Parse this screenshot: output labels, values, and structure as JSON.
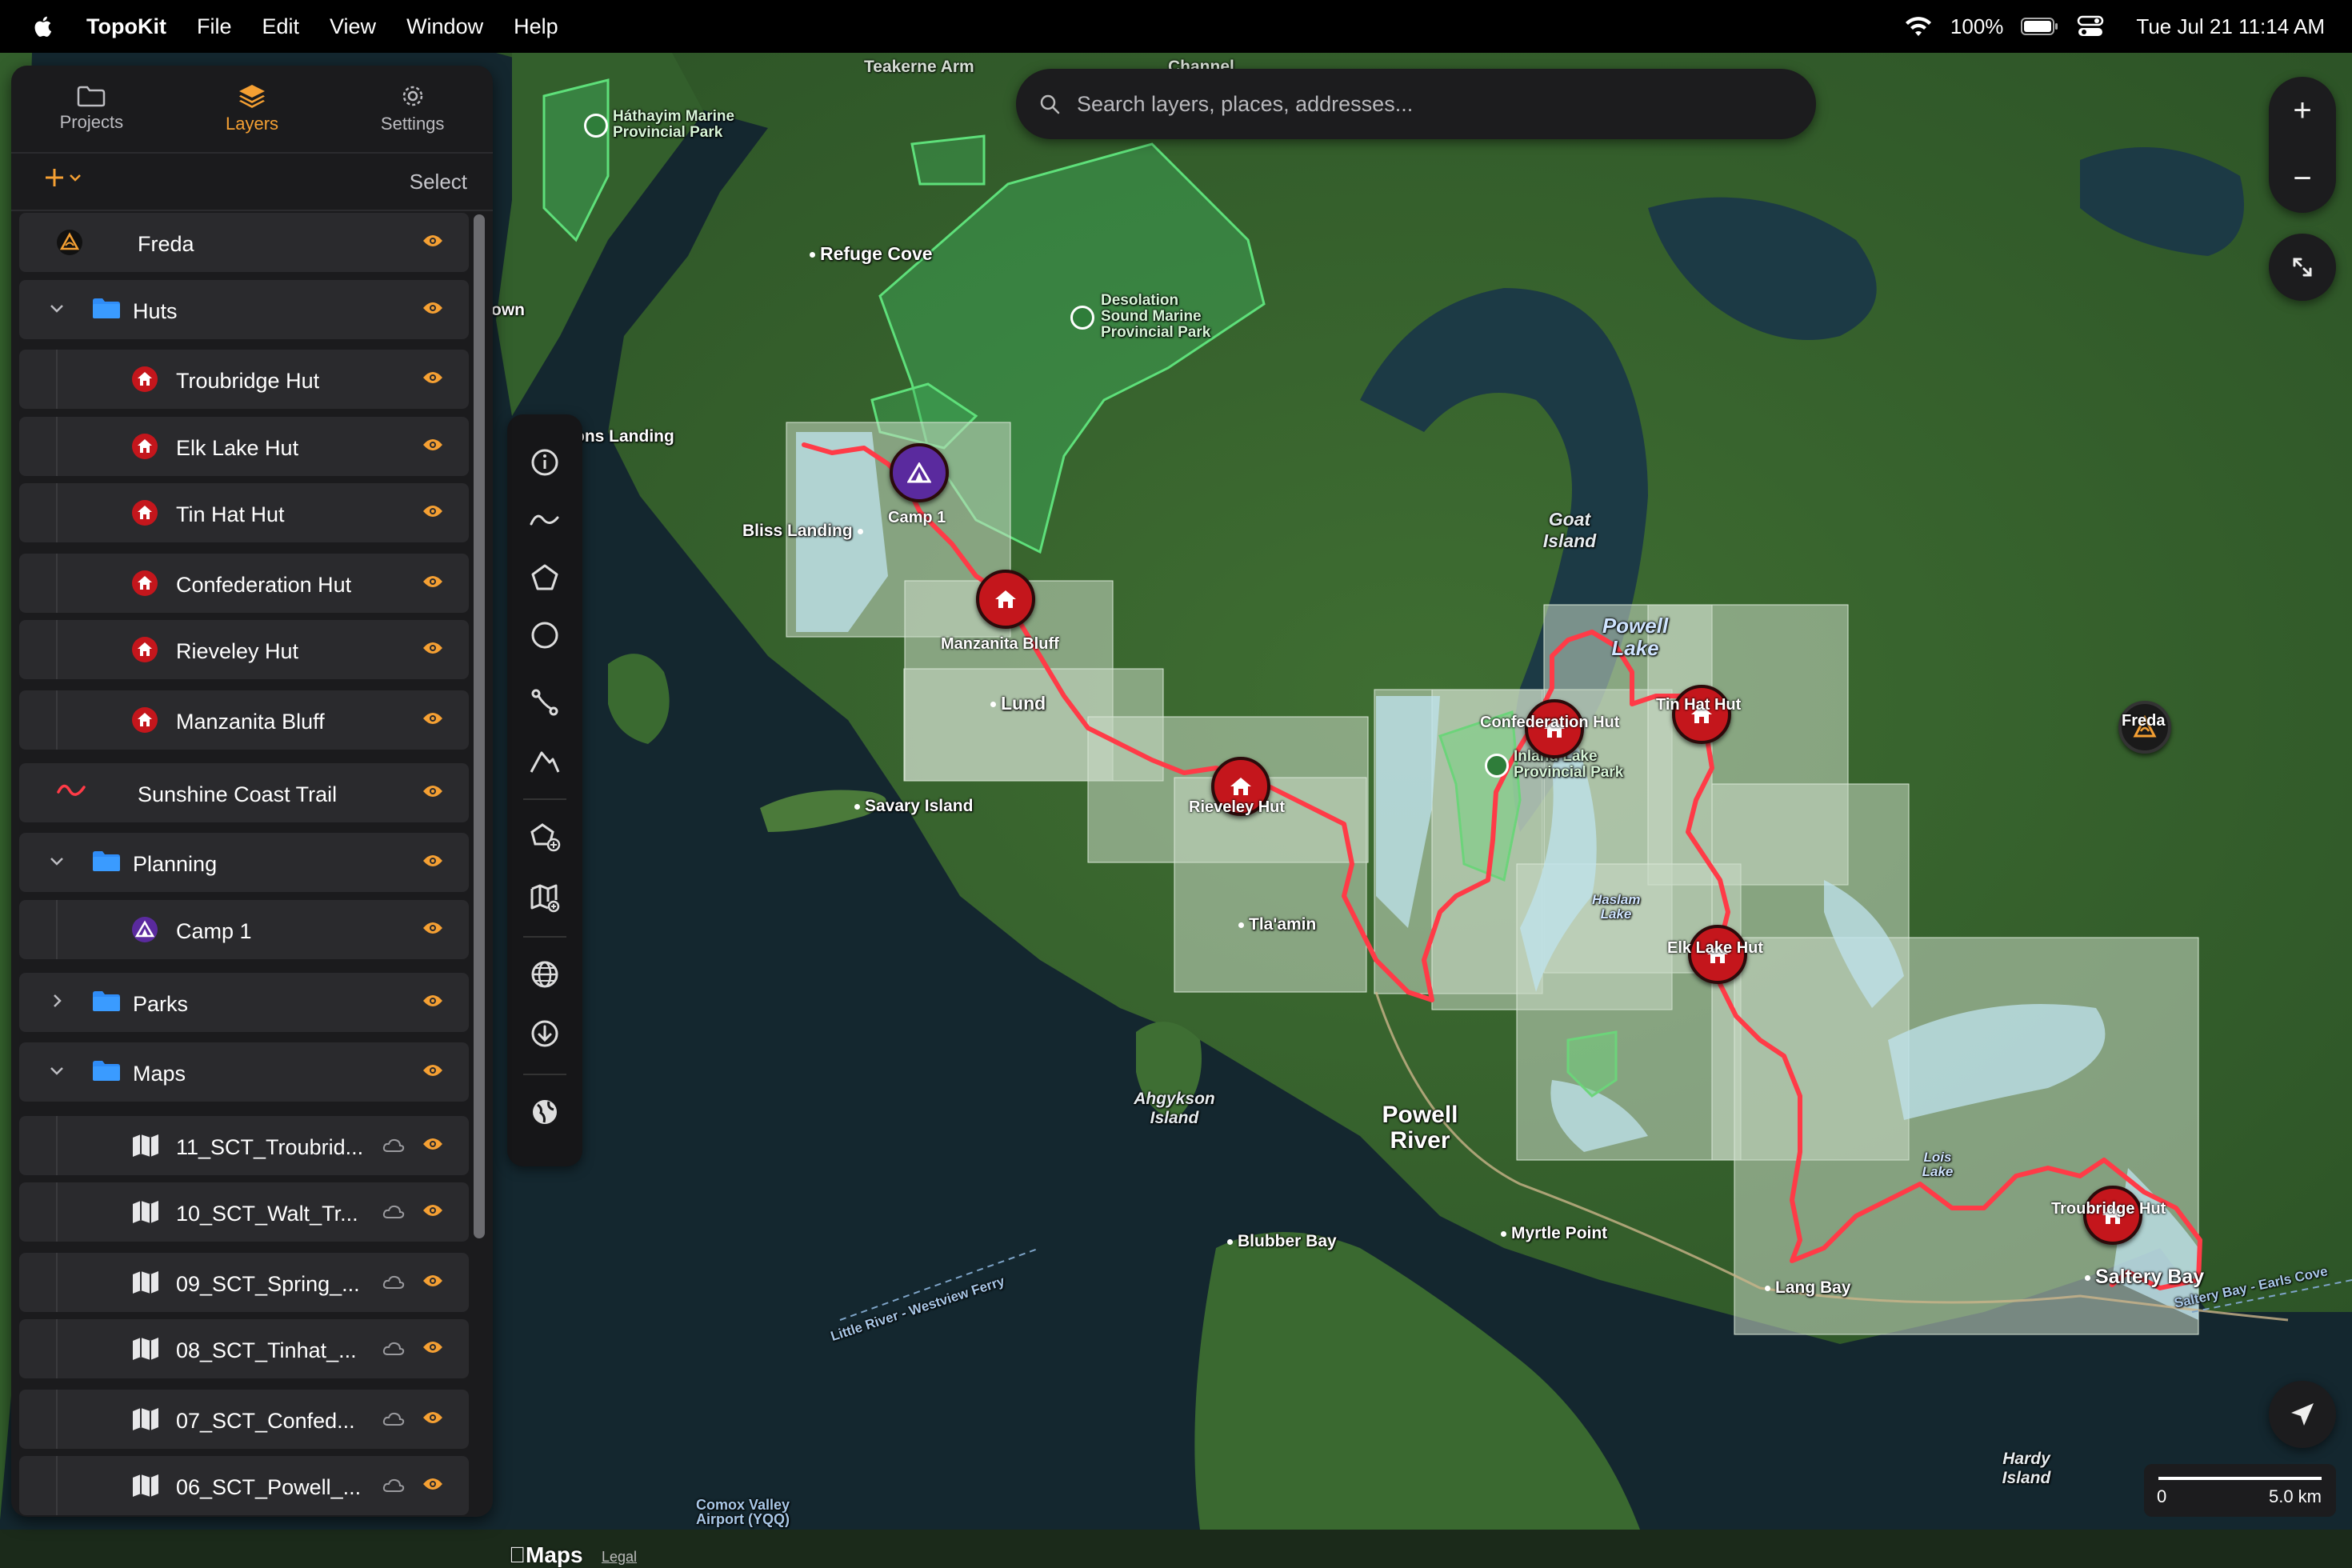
{
  "menubar": {
    "app_name": "TopoKit",
    "menus": [
      "File",
      "Edit",
      "View",
      "Window",
      "Help"
    ],
    "battery": "100%",
    "clock": "Tue Jul 21  11:14 AM"
  },
  "sidebar": {
    "tabs": [
      {
        "label": "Projects",
        "icon": "folder-icon"
      },
      {
        "label": "Layers",
        "icon": "layers-icon"
      },
      {
        "label": "Settings",
        "icon": "gear-icon"
      }
    ],
    "active_tab": "Layers",
    "select_label": "Select",
    "layers": [
      {
        "label": "Freda",
        "icon": "freda-icon",
        "indent": 0
      },
      {
        "label": "Huts",
        "icon": "folder-icon",
        "indent": 0,
        "expanded": true
      },
      {
        "label": "Troubridge Hut",
        "icon": "hut-icon",
        "indent": 1
      },
      {
        "label": "Elk Lake Hut",
        "icon": "hut-icon",
        "indent": 1
      },
      {
        "label": "Tin Hat Hut",
        "icon": "hut-icon",
        "indent": 1
      },
      {
        "label": "Confederation Hut",
        "icon": "hut-icon",
        "indent": 1
      },
      {
        "label": "Rieveley Hut",
        "icon": "hut-icon",
        "indent": 1
      },
      {
        "label": "Manzanita Bluff",
        "icon": "hut-icon",
        "indent": 1
      },
      {
        "label": "Sunshine Coast Trail",
        "icon": "track-icon",
        "indent": 0
      },
      {
        "label": "Planning",
        "icon": "folder-icon",
        "indent": 0,
        "expanded": true
      },
      {
        "label": "Camp 1",
        "icon": "camp-icon",
        "indent": 1
      },
      {
        "label": "Parks",
        "icon": "folder-icon",
        "indent": 0,
        "expanded": false
      },
      {
        "label": "Maps",
        "icon": "folder-icon",
        "indent": 0,
        "expanded": true
      },
      {
        "label": "11_SCT_Troubrid...",
        "icon": "map-icon",
        "indent": 1
      },
      {
        "label": "10_SCT_Walt_Tr...",
        "icon": "map-icon",
        "indent": 1
      },
      {
        "label": "09_SCT_Spring_...",
        "icon": "map-icon",
        "indent": 1
      },
      {
        "label": "08_SCT_Tinhat_...",
        "icon": "map-icon",
        "indent": 1
      },
      {
        "label": "07_SCT_Confed...",
        "icon": "map-icon",
        "indent": 1
      },
      {
        "label": "06_SCT_Powell_...",
        "icon": "map-icon",
        "indent": 1
      }
    ]
  },
  "search": {
    "placeholder": "Search layers, places, addresses..."
  },
  "map": {
    "places": [
      {
        "text": "Refuge Cove"
      },
      {
        "text": "Bliss Landing"
      },
      {
        "text": "Lund"
      },
      {
        "text": "Savary Island"
      },
      {
        "text": "Tla'amin"
      },
      {
        "text": "Blubber Bay"
      },
      {
        "text": "Myrtle Point"
      },
      {
        "text": "Lang Bay"
      },
      {
        "text": "Saltery Bay"
      },
      {
        "text": "Powell River"
      },
      {
        "text": "Goat Island"
      },
      {
        "text": "Powell Lake"
      },
      {
        "text": "Haslam Lake"
      },
      {
        "text": "Lois Lake"
      },
      {
        "text": "Ahgykson Island"
      },
      {
        "text": "Hardy Island"
      },
      {
        "text": "Little River - Westview Ferry"
      },
      {
        "text": "Saltery Bay - Earls Cove"
      },
      {
        "text": "Comox Valley Airport (YQQ)"
      },
      {
        "text": "Teakerne Arm"
      },
      {
        "text": "Channel"
      },
      {
        "text": "ons Landing"
      },
      {
        "text": "own"
      }
    ],
    "parks": [
      {
        "text": "Háthayim Marine Provincial Park"
      },
      {
        "text": "Desolation Sound Marine Provincial Park"
      },
      {
        "text": "Inland Lake Provincial Park"
      }
    ],
    "pins": [
      {
        "label": "Camp 1",
        "type": "camp"
      },
      {
        "label": "Manzanita Bluff",
        "type": "hut"
      },
      {
        "label": "Rieveley Hut",
        "type": "hut"
      },
      {
        "label": "Confederation Hut",
        "type": "hut"
      },
      {
        "label": "Tin Hat Hut",
        "type": "hut"
      },
      {
        "label": "Elk Lake Hut",
        "type": "hut"
      },
      {
        "label": "Troubridge Hut",
        "type": "hut"
      },
      {
        "label": "Freda",
        "type": "freda"
      }
    ],
    "scale": {
      "start": "0",
      "end": "5.0 km"
    },
    "attribution": {
      "logo": "Maps",
      "legal": "Legal"
    },
    "zoom_in": "+",
    "zoom_out": "−",
    "colors": {
      "trail": "#ff3b47",
      "accent": "#f5a033",
      "hut": "#c4161c",
      "camp": "#5a2a9e"
    }
  }
}
